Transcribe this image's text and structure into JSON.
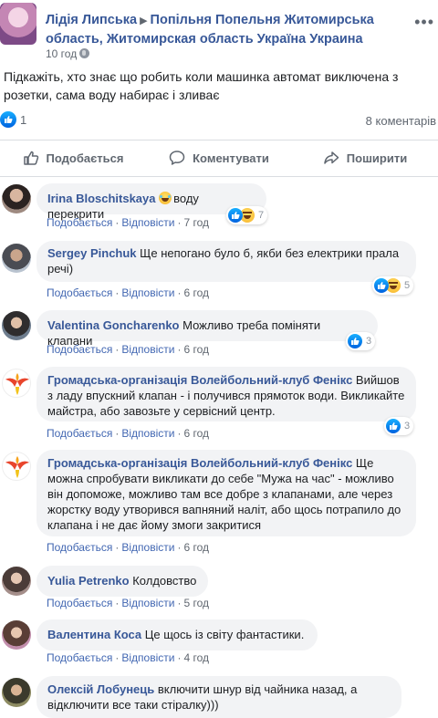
{
  "post": {
    "author": "Лідія Липська",
    "target": "Попільня Попельня Житомирська область, Житомирская область Україна Украина",
    "time": "10 год",
    "options_icon": "more-horizontal-icon",
    "body": "Підкажіть, хто знає що робить коли машинка автомат виключена з розетки, сама воду набирає і зливає",
    "likes": "1",
    "comments_count": "8 коментарів"
  },
  "actions": {
    "like": "Подобається",
    "comment": "Коментувати",
    "share": "Поширити"
  },
  "comment_actions": {
    "like": "Подобається",
    "reply": "Відповісти",
    "dot": "·"
  },
  "comments": [
    {
      "name": "Irina Bloschitskaya",
      "text": "воду перекрити",
      "time": "7 год",
      "reactions": "7",
      "reaction_types": [
        "like",
        "haha"
      ]
    },
    {
      "name": "Sergey Pinchuk",
      "text": "Ще непогано було б, якби без електрики прала речі)",
      "time": "6 год",
      "reactions": "5",
      "reaction_types": [
        "like",
        "haha"
      ]
    },
    {
      "name": "Valentina Goncharenko",
      "text": "Можливо треба поміняти клапани",
      "time": "6 год",
      "reactions": "3",
      "reaction_types": [
        "like"
      ]
    },
    {
      "name": "Громадська-організація Волейбольний-клуб Фенікс",
      "text": "Вийшов з ладу впускний клапан - і получився прямоток води. Викликайте майстра, або завозьте у сервісний центр.",
      "time": "6 год",
      "reactions": "3",
      "reaction_types": [
        "like"
      ]
    },
    {
      "name": "Громадська-організація Волейбольний-клуб Фенікс",
      "text": "Ще можна спробувати викликати до себе \"Мужа на час\" - можливо він допоможе, можливо там все добре з клапанами, але через жорстку воду утворився вапняний наліт, або щось потрапило до клапана і не дає йому змоги закритися",
      "time": "6 год",
      "reactions": "",
      "reaction_types": []
    },
    {
      "name": "Yulia Petrenko",
      "text": "Колдовство",
      "time": "5 год",
      "reactions": "",
      "reaction_types": []
    },
    {
      "name": "Валентина Коса",
      "text": "Це щось із світу фантастики.",
      "time": "4 год",
      "reactions": "",
      "reaction_types": []
    },
    {
      "name": "Олексій Лобунець",
      "text": "включити шнур від чайника назад, а відключити все таки стіралку)))",
      "time": "",
      "reactions": "",
      "reaction_types": []
    }
  ],
  "colors": {
    "link": "#385898",
    "meta": "#606770",
    "bubble": "#f2f3f5",
    "like_blue": "#1877f2"
  }
}
